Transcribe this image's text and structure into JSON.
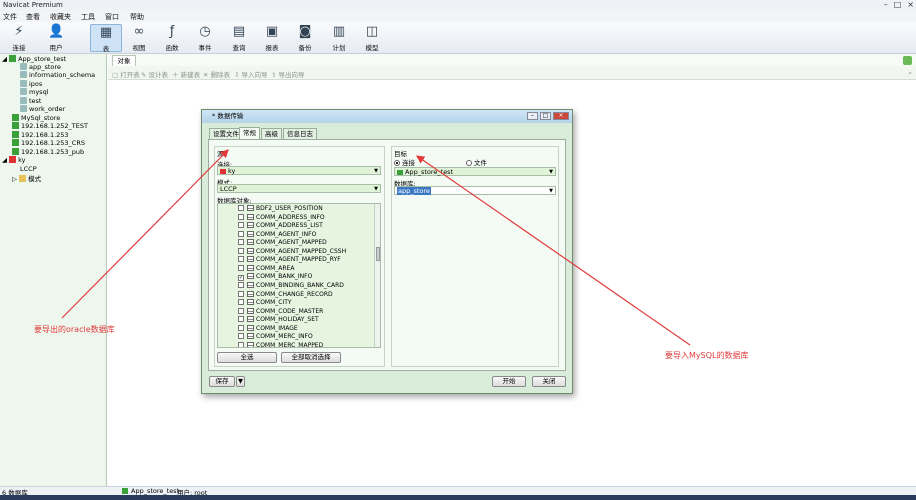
{
  "app": {
    "title": "Navicat Premium"
  },
  "menu": [
    "文件",
    "查看",
    "收藏夹",
    "工具",
    "窗口",
    "帮助"
  ],
  "toolbar": [
    {
      "label": "连接",
      "icon": "plug-icon"
    },
    {
      "label": "用户",
      "icon": "user-icon"
    },
    {
      "label": "表",
      "icon": "table-icon"
    },
    {
      "label": "视图",
      "icon": "glasses-icon"
    },
    {
      "label": "函数",
      "icon": "function-icon"
    },
    {
      "label": "事件",
      "icon": "event-icon"
    },
    {
      "label": "查询",
      "icon": "query-icon"
    },
    {
      "label": "报表",
      "icon": "report-icon"
    },
    {
      "label": "备份",
      "icon": "backup-icon"
    },
    {
      "label": "计划",
      "icon": "calendar-icon"
    },
    {
      "label": "模型",
      "icon": "model-icon"
    }
  ],
  "sidebar": {
    "items": [
      {
        "label": "App_store_test",
        "level": 0,
        "icon": "mysql-connection-icon"
      },
      {
        "label": "app_store",
        "level": 2,
        "icon": "database-icon"
      },
      {
        "label": "information_schema",
        "level": 2,
        "icon": "database-icon"
      },
      {
        "label": "ipos",
        "level": 2,
        "icon": "database-icon"
      },
      {
        "label": "mysql",
        "level": 2,
        "icon": "database-icon"
      },
      {
        "label": "test",
        "level": 2,
        "icon": "database-icon"
      },
      {
        "label": "work_order",
        "level": 2,
        "icon": "database-icon"
      },
      {
        "label": "MySql_store",
        "level": 1,
        "icon": "mysql-connection-icon"
      },
      {
        "label": "192.168.1.252_TEST",
        "level": 1,
        "icon": "mysql-connection-icon"
      },
      {
        "label": "192.168.1.253",
        "level": 1,
        "icon": "mysql-connection-icon"
      },
      {
        "label": "192.168.1.253_CRS",
        "level": 1,
        "icon": "mysql-connection-icon"
      },
      {
        "label": "192.168.1.253_pub",
        "level": 1,
        "icon": "mysql-connection-icon"
      },
      {
        "label": "ky",
        "level": 0,
        "icon": "oracle-connection-icon"
      },
      {
        "label": "LCCP",
        "level": 2,
        "icon": "schema-icon"
      },
      {
        "label": "模式",
        "level": 2,
        "icon": "folder-icon"
      }
    ]
  },
  "object_tab": "对象",
  "object_toolbar": [
    "打开表",
    "设计表",
    "新建表",
    "删除表",
    "导入向导",
    "导出向导"
  ],
  "status": {
    "left": "6 数据库",
    "connection": "App_store_test",
    "user": "用户: root"
  },
  "dialog": {
    "title": "* 数据传输",
    "tabs": [
      "设置文件",
      "常规",
      "高级",
      "信息日志"
    ],
    "active_tab": "常规",
    "source": {
      "group_label": "源",
      "connection_label": "连接:",
      "connection_value": "ky",
      "schema_label": "模式:",
      "schema_value": "LCCP",
      "objects_label": "数据库对象:",
      "objects": [
        {
          "name": "BDF2_USER_POSITION",
          "checked": false
        },
        {
          "name": "COMM_ADDRESS_INFO",
          "checked": false
        },
        {
          "name": "COMM_ADDRESS_LIST",
          "checked": false
        },
        {
          "name": "COMM_AGENT_INFO",
          "checked": false
        },
        {
          "name": "COMM_AGENT_MAPPED",
          "checked": false
        },
        {
          "name": "COMM_AGENT_MAPPED_CSSH",
          "checked": false
        },
        {
          "name": "COMM_AGENT_MAPPED_RYF",
          "checked": false
        },
        {
          "name": "COMM_AREA",
          "checked": false
        },
        {
          "name": "COMM_BANK_INFO",
          "checked": true
        },
        {
          "name": "COMM_BINDING_BANK_CARD",
          "checked": false
        },
        {
          "name": "COMM_CHANGE_RECORD",
          "checked": false
        },
        {
          "name": "COMM_CITY",
          "checked": false
        },
        {
          "name": "COMM_CODE_MASTER",
          "checked": false
        },
        {
          "name": "COMM_HOLIDAY_SET",
          "checked": false
        },
        {
          "name": "COMM_IMAGE",
          "checked": false
        },
        {
          "name": "COMM_MERC_INFO",
          "checked": false
        },
        {
          "name": "COMM_MERC_MAPPED",
          "checked": false
        }
      ],
      "select_all": "全选",
      "deselect_all": "全部取消选择"
    },
    "target": {
      "group_label": "目标",
      "radio_connection": "连接",
      "radio_file": "文件",
      "connection_value": "App_store_test",
      "database_label": "数据库:",
      "database_value": "app_store"
    },
    "save_button": "保存",
    "start_button": "开始",
    "close_button": "关闭"
  },
  "annotations": {
    "left": "要导出的oracle数据库",
    "right": "要导入MySQL的数据库",
    "color": "#e03a3a"
  }
}
